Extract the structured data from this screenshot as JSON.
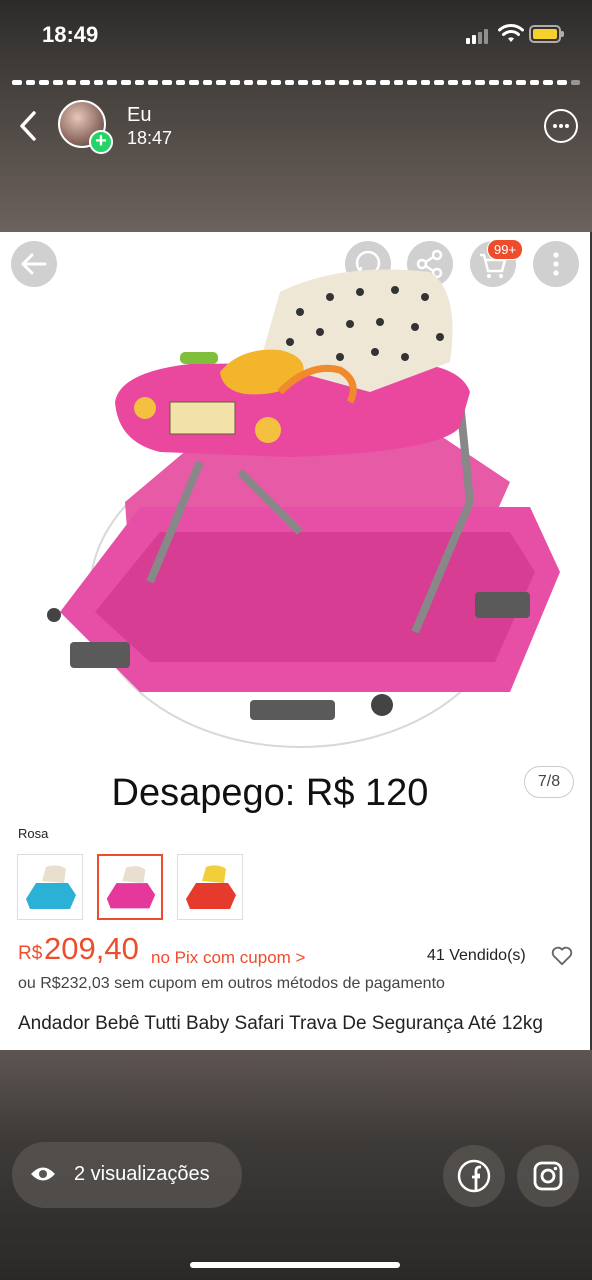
{
  "status_bar": {
    "time": "18:49"
  },
  "story": {
    "user_name": "Eu",
    "posted_time": "18:47",
    "segments_total": 1
  },
  "product": {
    "cart_badge": "99+",
    "headline": "Desapego: R$ 120",
    "image_counter": "7/8",
    "variant_label": "Rosa",
    "variants": [
      {
        "color": "#2bb0d6",
        "selected": false
      },
      {
        "color": "#e6389c",
        "selected": true
      },
      {
        "color": "#e63a2c",
        "selected": false
      }
    ],
    "price_currency": "R$",
    "price_value": "209,40",
    "pix_text": "no Pix com cupom >",
    "sold_text": "41 Vendido(s)",
    "other_methods": "ou R$232,03 sem cupom em outros métodos de pagamento",
    "title": "Andador Bebê Tutti Baby Safari Trava De Segurança Até 12kg",
    "accent_color": "#ee4d2d"
  },
  "footer": {
    "views_label": "2 visualizações",
    "share_targets": [
      "facebook-icon",
      "instagram-icon"
    ]
  }
}
